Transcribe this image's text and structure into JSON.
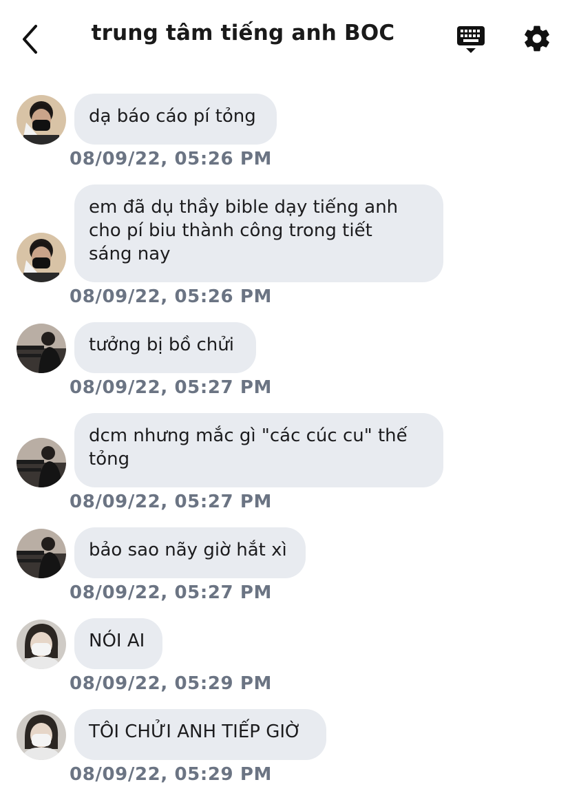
{
  "header": {
    "title": "trung tâm tiếng anh BOC",
    "back_icon": "chevron-left-icon",
    "keyboard_icon": "keyboard-icon",
    "settings_icon": "gear-icon"
  },
  "messages": [
    {
      "text": "dạ báo cáo pí tỏng",
      "time": "08/09/22, 05:26 PM",
      "avatar": "user-a"
    },
    {
      "text": "em đã dụ thầy bible dạy tiếng anh\ncho pí biu thành công trong tiết\nsáng nay",
      "time": "08/09/22, 05:26 PM",
      "avatar": "user-a"
    },
    {
      "text": "tưởng bị bồ chửi",
      "time": "08/09/22, 05:27 PM",
      "avatar": "user-b"
    },
    {
      "text": "dcm nhưng mắc gì \"các cúc cu\" thế\ntỏng",
      "time": "08/09/22, 05:27 PM",
      "avatar": "user-b"
    },
    {
      "text": "bảo sao nãy giờ hắt xì",
      "time": "08/09/22, 05:27 PM",
      "avatar": "user-b"
    },
    {
      "text": "NÓI AI",
      "time": "08/09/22, 05:29 PM",
      "avatar": "user-c"
    },
    {
      "text": "TÔI CHỬI ANH TIẾP GIỜ",
      "time": "08/09/22, 05:29 PM",
      "avatar": "user-c"
    }
  ]
}
